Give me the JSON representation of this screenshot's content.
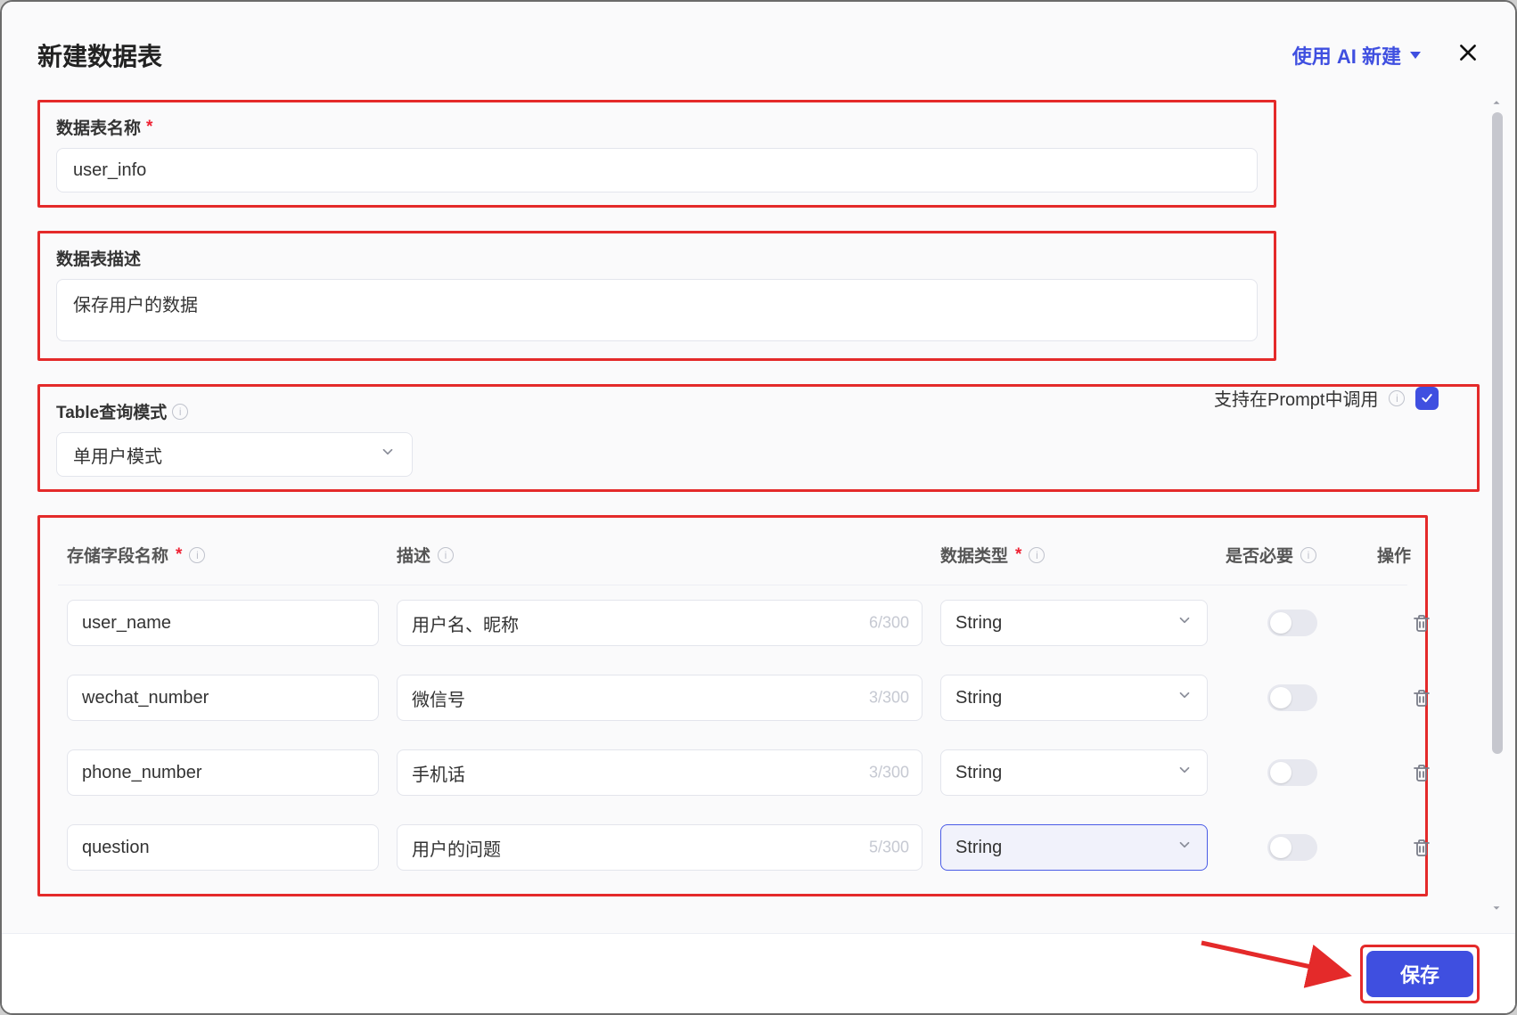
{
  "header": {
    "title": "新建数据表",
    "ai_link": "使用 AI 新建"
  },
  "sections": {
    "name": {
      "label": "数据表名称",
      "value": "user_info"
    },
    "desc": {
      "label": "数据表描述",
      "value": "保存用户的数据"
    },
    "mode": {
      "label": "Table查询模式",
      "selected": "单用户模式"
    },
    "prompt": {
      "label": "支持在Prompt中调用",
      "checked": true
    }
  },
  "fields": {
    "headers": {
      "name": "存储字段名称",
      "desc": "描述",
      "type": "数据类型",
      "required": "是否必要",
      "actions": "操作"
    },
    "rows": [
      {
        "name": "user_name",
        "desc": "用户名、昵称",
        "count": "6/300",
        "type": "String",
        "required": false,
        "focused": false
      },
      {
        "name": "wechat_number",
        "desc": "微信号",
        "count": "3/300",
        "type": "String",
        "required": false,
        "focused": false
      },
      {
        "name": "phone_number",
        "desc": "手机话",
        "count": "3/300",
        "type": "String",
        "required": false,
        "focused": false
      },
      {
        "name": "question",
        "desc": "用户的问题",
        "count": "5/300",
        "type": "String",
        "required": false,
        "focused": true
      }
    ]
  },
  "footer": {
    "save": "保存"
  }
}
